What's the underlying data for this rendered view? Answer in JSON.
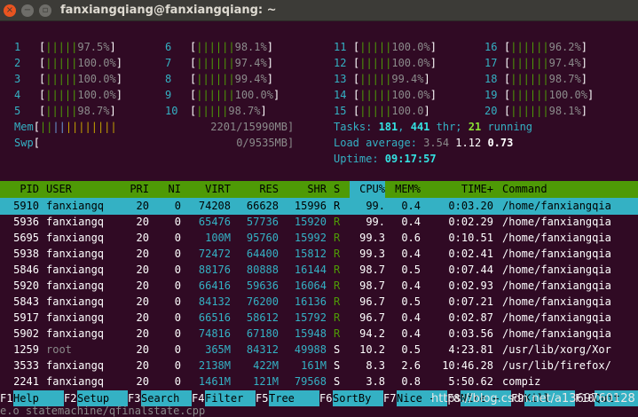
{
  "window": {
    "title": "fanxiangqiang@fanxiangqiang: ~",
    "close_glyph": "×",
    "min_glyph": "−",
    "max_glyph": "▫"
  },
  "cpus": [
    {
      "n": "1",
      "bar": "|||||",
      "p": "97.5%"
    },
    {
      "n": "2",
      "bar": "|||||",
      "p": "100.0%"
    },
    {
      "n": "3",
      "bar": "|||||",
      "p": "100.0%"
    },
    {
      "n": "4",
      "bar": "|||||",
      "p": "100.0%"
    },
    {
      "n": "5",
      "bar": "|||||",
      "p": "98.7%"
    },
    {
      "n": "6",
      "bar": "||||||",
      "p": "98.1%"
    },
    {
      "n": "7",
      "bar": "||||||",
      "p": "97.4%"
    },
    {
      "n": "8",
      "bar": "||||||",
      "p": "99.4%"
    },
    {
      "n": "9",
      "bar": "||||||",
      "p": "100.0%"
    },
    {
      "n": "10",
      "bar": "|||||",
      "p": "98.7%"
    },
    {
      "n": "11",
      "bar": "|||||",
      "p": "100.0%"
    },
    {
      "n": "12",
      "bar": "|||||",
      "p": "100.0%"
    },
    {
      "n": "13",
      "bar": "|||||",
      "p": "99.4%"
    },
    {
      "n": "14",
      "bar": "|||||",
      "p": "100.0%"
    },
    {
      "n": "15",
      "bar": "|||||",
      "p": "100.0"
    },
    {
      "n": "16",
      "bar": "||||||",
      "p": "96.2%"
    },
    {
      "n": "17",
      "bar": "||||||",
      "p": "97.4%"
    },
    {
      "n": "18",
      "bar": "||||||",
      "p": "98.7%"
    },
    {
      "n": "19",
      "bar": "||||||",
      "p": "100.0%"
    },
    {
      "n": "20",
      "bar": "||||||",
      "p": "98.1%"
    }
  ],
  "mem": {
    "label": "Mem",
    "bar": "||||||||",
    "value": "2201/15990MB"
  },
  "swp": {
    "label": "Swp",
    "value": "0/9535MB"
  },
  "tasks": {
    "label": "Tasks: ",
    "count": "181",
    "sep": ", ",
    "threads": "441",
    "thr": " thr; ",
    "running": "21",
    "running_label": " running"
  },
  "load": {
    "label": "Load average: ",
    "l1": "3.54",
    "l5": "1.12",
    "l15": "0.73"
  },
  "uptime": {
    "label": "Uptime: ",
    "value": "09:17:57"
  },
  "columns": [
    "PID",
    "USER",
    "PRI",
    "NI",
    "VIRT",
    "RES",
    "SHR",
    "S",
    "CPU%",
    "MEM%",
    "TIME+",
    "Command"
  ],
  "processes": [
    {
      "pid": "5910",
      "user": "fanxiangq",
      "pri": "20",
      "ni": "0",
      "virt": "74208",
      "res": "66628",
      "shr": "15996",
      "s": "R",
      "cpu": "99.",
      "mem": "0.4",
      "time": "0:03.20",
      "cmd": "/home/fanxiangqia"
    },
    {
      "pid": "5936",
      "user": "fanxiangq",
      "pri": "20",
      "ni": "0",
      "virt": "65476",
      "res": "57736",
      "shr": "15920",
      "s": "R",
      "cpu": "99.",
      "mem": "0.4",
      "time": "0:02.29",
      "cmd": "/home/fanxiangqia"
    },
    {
      "pid": "5695",
      "user": "fanxiangq",
      "pri": "20",
      "ni": "0",
      "virt": "100M",
      "res": "95760",
      "shr": "15992",
      "s": "R",
      "cpu": "99.3",
      "mem": "0.6",
      "time": "0:10.51",
      "cmd": "/home/fanxiangqia"
    },
    {
      "pid": "5938",
      "user": "fanxiangq",
      "pri": "20",
      "ni": "0",
      "virt": "72472",
      "res": "64400",
      "shr": "15812",
      "s": "R",
      "cpu": "99.3",
      "mem": "0.4",
      "time": "0:02.41",
      "cmd": "/home/fanxiangqia"
    },
    {
      "pid": "5846",
      "user": "fanxiangq",
      "pri": "20",
      "ni": "0",
      "virt": "88176",
      "res": "80888",
      "shr": "16144",
      "s": "R",
      "cpu": "98.7",
      "mem": "0.5",
      "time": "0:07.44",
      "cmd": "/home/fanxiangqia"
    },
    {
      "pid": "5920",
      "user": "fanxiangq",
      "pri": "20",
      "ni": "0",
      "virt": "66416",
      "res": "59636",
      "shr": "16064",
      "s": "R",
      "cpu": "98.7",
      "mem": "0.4",
      "time": "0:02.93",
      "cmd": "/home/fanxiangqia"
    },
    {
      "pid": "5843",
      "user": "fanxiangq",
      "pri": "20",
      "ni": "0",
      "virt": "84132",
      "res": "76200",
      "shr": "16136",
      "s": "R",
      "cpu": "96.7",
      "mem": "0.5",
      "time": "0:07.21",
      "cmd": "/home/fanxiangqia"
    },
    {
      "pid": "5917",
      "user": "fanxiangq",
      "pri": "20",
      "ni": "0",
      "virt": "66516",
      "res": "58612",
      "shr": "15792",
      "s": "R",
      "cpu": "96.7",
      "mem": "0.4",
      "time": "0:02.87",
      "cmd": "/home/fanxiangqia"
    },
    {
      "pid": "5902",
      "user": "fanxiangq",
      "pri": "20",
      "ni": "0",
      "virt": "74816",
      "res": "67180",
      "shr": "15948",
      "s": "R",
      "cpu": "94.2",
      "mem": "0.4",
      "time": "0:03.56",
      "cmd": "/home/fanxiangqia"
    },
    {
      "pid": "1259",
      "user": "root",
      "pri": "20",
      "ni": "0",
      "virt": "365M",
      "res": "84312",
      "shr": "49988",
      "s": "S",
      "cpu": "10.2",
      "mem": "0.5",
      "time": "4:23.81",
      "cmd": "/usr/lib/xorg/Xor"
    },
    {
      "pid": "3533",
      "user": "fanxiangq",
      "pri": "20",
      "ni": "0",
      "virt": "2138M",
      "res": "422M",
      "shr": "161M",
      "s": "S",
      "cpu": "8.3",
      "mem": "2.6",
      "time": "10:46.28",
      "cmd": "/usr/lib/firefox/"
    },
    {
      "pid": "2241",
      "user": "fanxiangq",
      "pri": "20",
      "ni": "0",
      "virt": "1461M",
      "res": "121M",
      "shr": "79568",
      "s": "S",
      "cpu": "3.8",
      "mem": "0.8",
      "time": "5:50.62",
      "cmd": "compiz"
    }
  ],
  "fkeys": [
    {
      "k": "F1",
      "l": "Help"
    },
    {
      "k": "F2",
      "l": "Setup"
    },
    {
      "k": "F3",
      "l": "Search"
    },
    {
      "k": "F4",
      "l": "Filter"
    },
    {
      "k": "F5",
      "l": "Tree"
    },
    {
      "k": "F6",
      "l": "SortBy"
    },
    {
      "k": "F7",
      "l": "Nice -"
    },
    {
      "k": "F8",
      "l": "Nice +"
    },
    {
      "k": "F9",
      "l": "Kill"
    },
    {
      "k": "F10",
      "l": "Quit"
    }
  ],
  "stale_text": "e.o statemachine/qfinalstate.cpp",
  "watermark": "https://blog.csdn.net/a1369760128"
}
